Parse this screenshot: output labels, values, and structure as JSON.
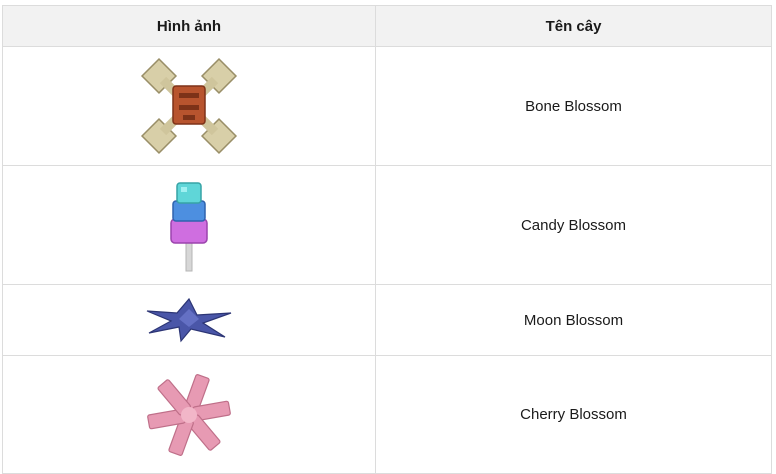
{
  "table": {
    "headers": [
      "Hình ảnh",
      "Tên cây"
    ],
    "rows": [
      {
        "image_icon": "bone-blossom-icon",
        "name": "Bone Blossom"
      },
      {
        "image_icon": "candy-blossom-icon",
        "name": "Candy Blossom"
      },
      {
        "image_icon": "moon-blossom-icon",
        "name": "Moon Blossom"
      },
      {
        "image_icon": "cherry-blossom-icon",
        "name": "Cherry Blossom"
      }
    ]
  },
  "colors": {
    "header_bg": "#f2f2f2",
    "border": "#dcdcdc",
    "bone": "#d8cfa8",
    "bone_center": "#b8542e",
    "candy_top": "#5fd6d8",
    "candy_mid": "#4d8fe0",
    "candy_bottom": "#cf6ee0",
    "moon": "#4a56a8",
    "cherry": "#e79ab3"
  }
}
